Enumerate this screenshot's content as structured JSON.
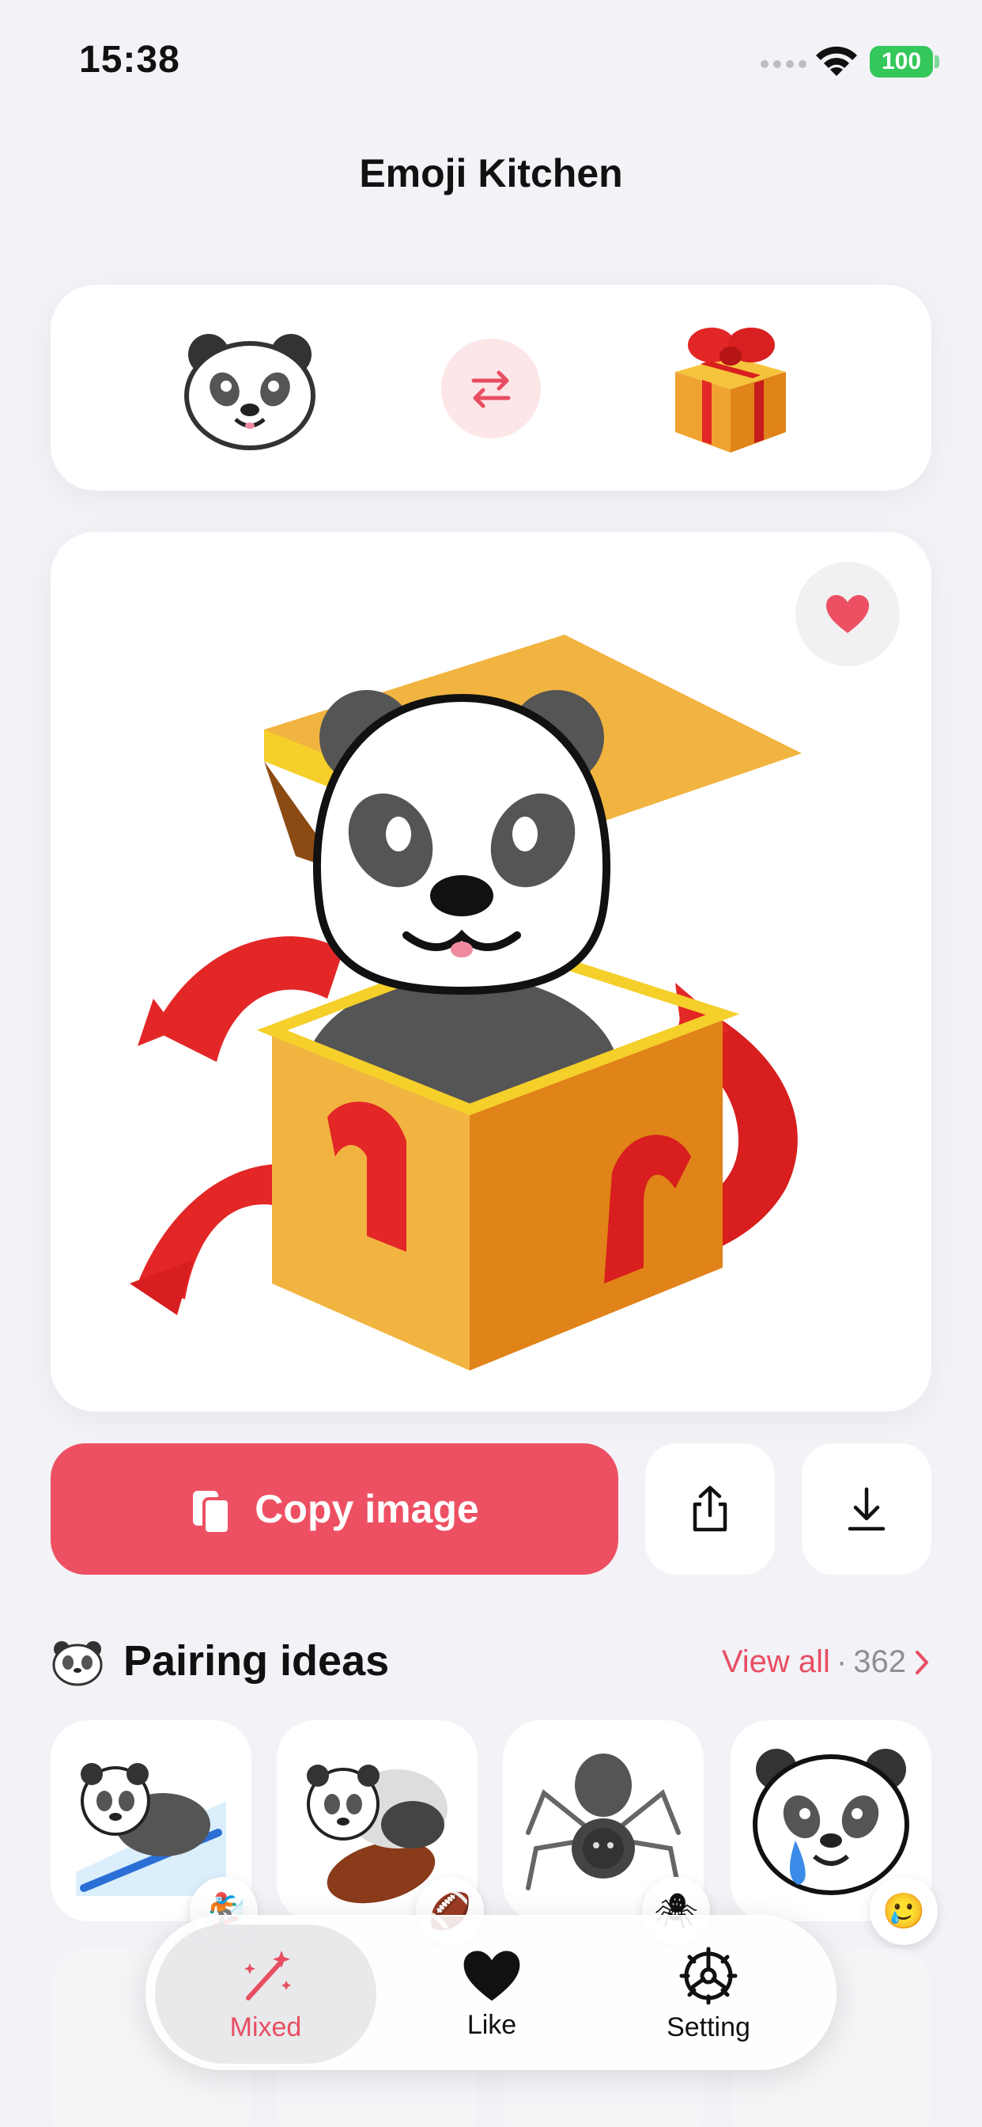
{
  "status_bar": {
    "time": "15:38",
    "battery": "100"
  },
  "header": {
    "title": "Emoji Kitchen"
  },
  "picker": {
    "left_emoji": "panda-face",
    "right_emoji": "wrapped-gift",
    "swap_icon": "swap-arrows-icon"
  },
  "preview": {
    "image": "panda-in-gift-box",
    "favorite_icon": "heart-icon",
    "accent": "#ee5063"
  },
  "actions": {
    "copy_label": "Copy image",
    "share_icon": "share-icon",
    "download_icon": "download-icon"
  },
  "pairing": {
    "title": "Pairing ideas",
    "view_all": "View all",
    "separator": "·",
    "count": "362",
    "items": [
      {
        "name": "panda-snowboarder",
        "badge": "🏂"
      },
      {
        "name": "panda-football",
        "badge": "🏈"
      },
      {
        "name": "panda-spider",
        "badge": "🕷"
      },
      {
        "name": "panda-crying",
        "badge": "🥲"
      }
    ]
  },
  "tab_bar": {
    "tabs": [
      {
        "label": "Mixed",
        "icon": "magic-wand-icon",
        "active": true
      },
      {
        "label": "Like",
        "icon": "heart-icon",
        "active": false
      },
      {
        "label": "Setting",
        "icon": "gear-icon",
        "active": false
      }
    ]
  }
}
